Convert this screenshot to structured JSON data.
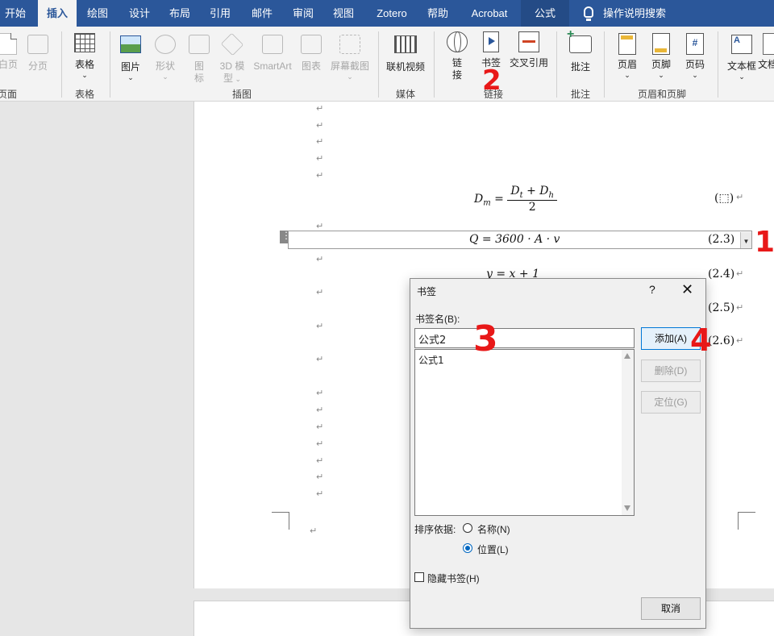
{
  "tabs": [
    {
      "label": "开始"
    },
    {
      "label": "插入"
    },
    {
      "label": "绘图"
    },
    {
      "label": "设计"
    },
    {
      "label": "布局"
    },
    {
      "label": "引用"
    },
    {
      "label": "邮件"
    },
    {
      "label": "审阅"
    },
    {
      "label": "视图"
    },
    {
      "label": "Zotero"
    },
    {
      "label": "帮助"
    },
    {
      "label": "Acrobat"
    },
    {
      "label": "公式"
    }
  ],
  "active_tab": "插入",
  "help_search": "操作说明搜索",
  "ribbon": {
    "pages": {
      "blank_page": "白页",
      "page_break": "分页",
      "group": "页面"
    },
    "tables": {
      "table": "表格",
      "group": "表格"
    },
    "illustrations": {
      "picture": "图片",
      "shapes": "形状",
      "icons_line1": "图",
      "icons_line2": "标",
      "model3d_line1": "3D 模",
      "model3d_line2": "型",
      "smartart": "SmartArt",
      "chart": "图表",
      "screenshot": "屏幕截图",
      "group": "插图"
    },
    "media": {
      "online_video": "联机视频",
      "group": "媒体"
    },
    "links": {
      "link_line1": "链",
      "link_line2": "接",
      "bookmark": "书签",
      "cross_ref": "交叉引用",
      "group": "链接"
    },
    "comments": {
      "comment": "批注",
      "group": "批注"
    },
    "header_footer": {
      "header": "页眉",
      "footer": "页脚",
      "page_number": "页码",
      "group": "页眉和页脚"
    },
    "text": {
      "textbox": "文本框",
      "text_more": "文档"
    }
  },
  "document": {
    "eq1": {
      "lhs": "D",
      "lhs_sub": "m",
      "num": "D",
      "num_sub1": "t",
      "num_plus": " + D",
      "num_sub2": "h",
      "den": "2",
      "number": "(⬚)"
    },
    "eq2": {
      "text": "Q = 3600 · A · v",
      "number": "(2.3)"
    },
    "eq3": {
      "text": "y = x + 1",
      "number": "(2.4)"
    },
    "eq4": {
      "number": "(2.5)"
    },
    "eq5": {
      "number": "(2.6)"
    },
    "para_mark": "↵"
  },
  "dialog": {
    "title": "书签",
    "help": "?",
    "close": "✕",
    "name_label": "书签名(B):",
    "name_value": "公式2",
    "list": [
      "公式1"
    ],
    "add": "添加(A)",
    "delete": "删除(D)",
    "goto": "定位(G)",
    "sort_label": "排序依据:",
    "sort_name": "名称(N)",
    "sort_position": "位置(L)",
    "hidden": "隐藏书签(H)",
    "cancel": "取消"
  },
  "annotations": [
    "1",
    "2",
    "3",
    "4"
  ],
  "colors": {
    "tabbar": "#2b579a",
    "annotation": "#e81818",
    "ribbon": "#f3f3f3"
  }
}
